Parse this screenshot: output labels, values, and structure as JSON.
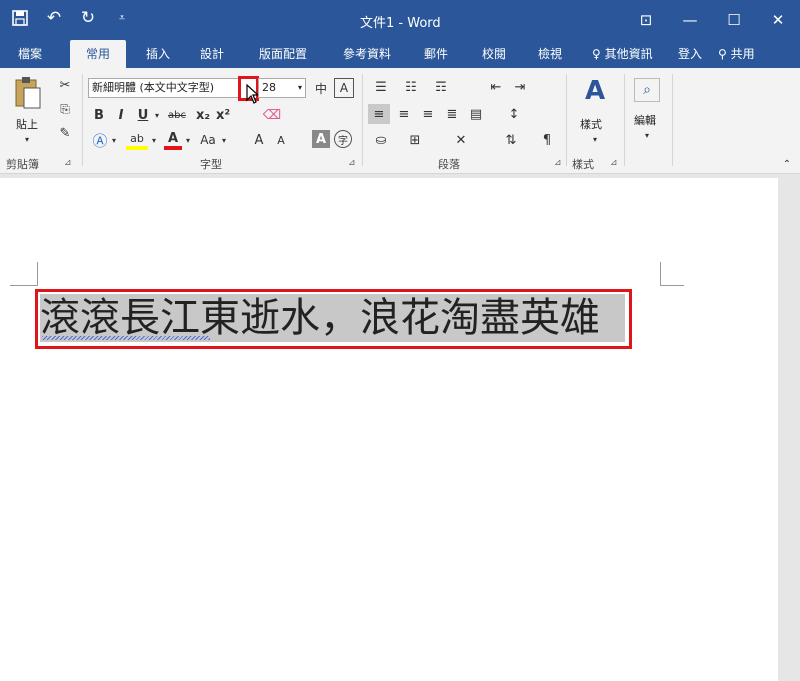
{
  "window": {
    "title": "文件1 - Word",
    "colors": {
      "titlebar": "#2b579a",
      "ribbon": "#f3f3f3",
      "highlight": "#e0141b"
    }
  },
  "quick_access": [
    "save-icon",
    "undo-icon",
    "redo-icon",
    "customize-icon"
  ],
  "tabs": [
    {
      "label": "檔案",
      "active": false
    },
    {
      "label": "常用",
      "active": true
    },
    {
      "label": "插入",
      "active": false
    },
    {
      "label": "設計",
      "active": false
    },
    {
      "label": "版面配置",
      "active": false
    },
    {
      "label": "參考資料",
      "active": false
    },
    {
      "label": "郵件",
      "active": false
    },
    {
      "label": "校閱",
      "active": false
    },
    {
      "label": "檢視",
      "active": false
    }
  ],
  "tell_me": "其他資訊",
  "sign_in": "登入",
  "share": "共用",
  "ribbon": {
    "clipboard": {
      "paste_label": "貼上",
      "group_label": "剪貼簿"
    },
    "font": {
      "font_name": "新細明體 (本文中文字型)",
      "font_size": "28",
      "group_label": "字型",
      "buttons": [
        "B",
        "I",
        "U",
        "abc",
        "x₂",
        "x²",
        "Aa",
        "A",
        "A"
      ]
    },
    "paragraph": {
      "group_label": "段落"
    },
    "styles": {
      "label": "樣式",
      "group_label": "樣式"
    },
    "editing": {
      "label": "編輯"
    }
  },
  "document": {
    "text": "滾滾長江東逝水，浪花淘盡英雄"
  }
}
